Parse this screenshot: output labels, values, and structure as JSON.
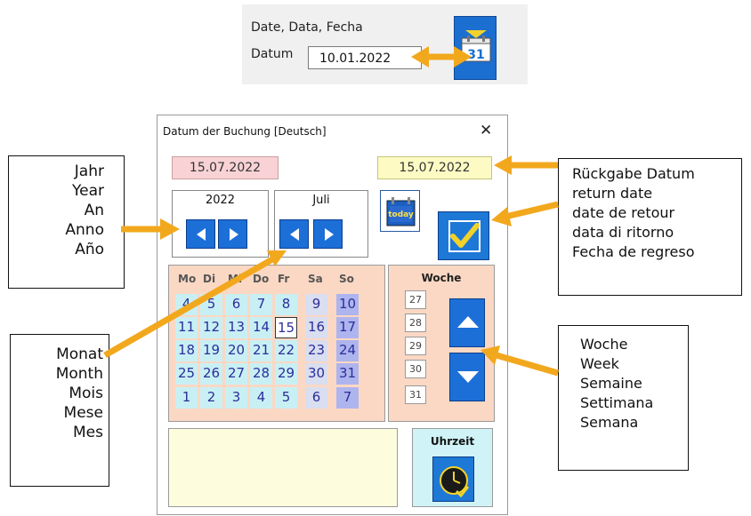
{
  "top": {
    "title": "Date, Data, Fecha",
    "label": "Datum",
    "value": "10.01.2022",
    "calendar_icon_day": "31"
  },
  "dialog": {
    "title": "Datum der Buchung   [Deutsch]",
    "close": "✕",
    "date_left": "15.07.2022",
    "date_right": "15.07.2022",
    "year_label": "2022",
    "month_label": "Juli",
    "today_icon_text": "today",
    "weekday_headers": [
      "Mo",
      "Di",
      "Mi",
      "Do",
      "Fr",
      "Sa",
      "So"
    ],
    "weeks": [
      [
        "4",
        "5",
        "6",
        "7",
        "8",
        "9",
        "10"
      ],
      [
        "11",
        "12",
        "13",
        "14",
        "15",
        "16",
        "17"
      ],
      [
        "18",
        "19",
        "20",
        "21",
        "22",
        "23",
        "24"
      ],
      [
        "25",
        "26",
        "27",
        "28",
        "29",
        "30",
        "31"
      ],
      [
        "1",
        "2",
        "3",
        "4",
        "5",
        "6",
        "7"
      ]
    ],
    "selected_day": "15",
    "week_label": "Woche",
    "week_numbers": [
      "27",
      "28",
      "29",
      "30",
      "31"
    ],
    "time_label": "Uhrzeit"
  },
  "callouts": {
    "year": [
      "Jahr",
      "Year",
      "An",
      "Anno",
      "Año"
    ],
    "month": [
      "Monat",
      "Month",
      "Mois",
      "Mese",
      "Mes"
    ],
    "return_date": [
      "Rückgabe Datum",
      "return date",
      "date de retour",
      "data di ritorno",
      "Fecha de regreso"
    ],
    "week": [
      "Woche",
      "Week",
      "Semaine",
      "Settimana",
      "Semana"
    ]
  },
  "colors": {
    "accent_blue": "#1d6fd8",
    "arrow_orange": "#f2a81d",
    "calendar_peach": "#fbd8c4"
  }
}
